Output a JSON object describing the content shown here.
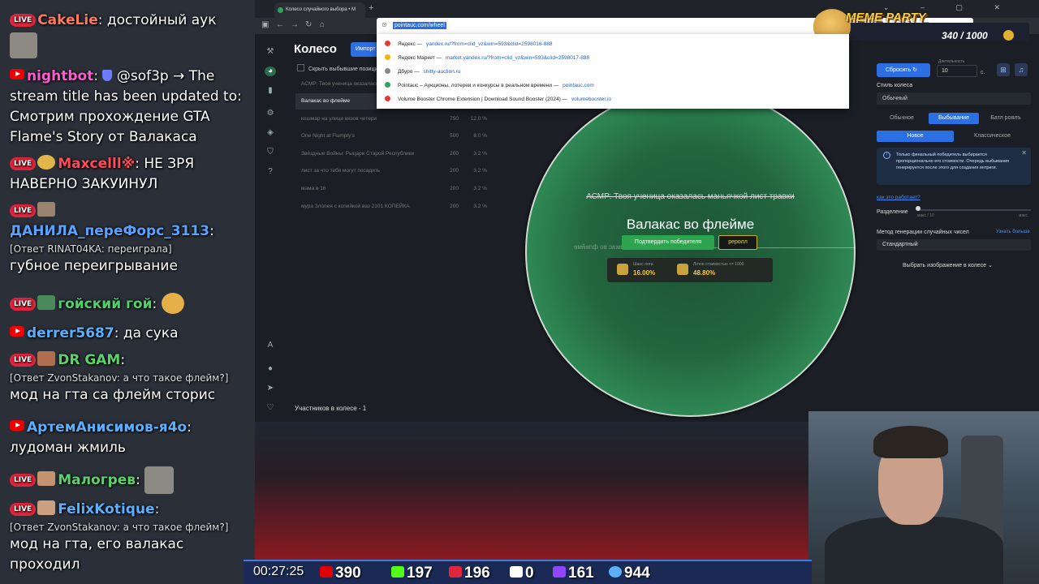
{
  "chat": {
    "messages": [
      {
        "user": "CakeLie",
        "text": "достойный аук",
        "color": "#ff7a5c",
        "platform": "live"
      },
      {
        "user": "nightbot",
        "text": "@sof3p → The stream title has been updated to: Смотрим прохождение GTA Flame's Story от Валакаса",
        "color": "#ff5ad0",
        "platform": "youtube"
      },
      {
        "user": "Maxcelll※",
        "text": "НЕ ЗРЯ НАВЕРНО ЗАКУИНУЛ",
        "color": "#ff4a5a",
        "platform": "live"
      },
      {
        "user": "ДАНИЛА_переФорс_3113",
        "reply": "[Ответ RINAT04KA: переиграла]",
        "text": "губное переигрывание",
        "color": "#5aa2ff",
        "platform": "live"
      },
      {
        "user": "гойский гой",
        "text": "",
        "color": "#4bd36a",
        "platform": "live"
      },
      {
        "user": "derrer5687",
        "text": "да сука",
        "color": "#5ab0ff",
        "platform": "youtube"
      },
      {
        "user": "DR GAM",
        "reply": "[Ответ ZvonStakanov: а что такое флейм?]",
        "text": "мод на гта са флейм сторис",
        "color": "#5ad46a",
        "platform": "live"
      },
      {
        "user": "АртемАнисимов-я4о",
        "text": "лудоман жмиль",
        "color": "#5ab0ff",
        "platform": "youtube"
      },
      {
        "user": "Малогрев",
        "text": "",
        "color": "#5ad46a",
        "platform": "live"
      },
      {
        "user": "FelixKotique",
        "reply": "[Ответ ZvonStakanov: а что такое флейм?]",
        "text": "мод на гта, его валакас проходил",
        "color": "#5ab0ff",
        "platform": "live"
      }
    ]
  },
  "browser": {
    "tab_title": "Колесо случайного выбора • М",
    "url": "pointauc.com/wheel",
    "suggestions": [
      {
        "title": "Яндекс",
        "url": "yandex.ru/?from=clid_vz&win=593&clid=2598016-888",
        "color": "#e53935"
      },
      {
        "title": "Яндекс Маркет",
        "url": "market.yandex.ru/?from=clid_vz&win=593&clid=2598017-888",
        "color": "#f5b400"
      },
      {
        "title": "Дбурo",
        "url": "shitty-auction.ru",
        "color": "#888888"
      },
      {
        "title": "Pointauc – Аукционы, лотереи и конкурсы в реальном времени",
        "url": "pointauc.com",
        "color": "#2ca55a"
      },
      {
        "title": "Volume Booster Chrome Extension | Download Sound Booster (2024)",
        "url": "volumebooster.io",
        "color": "#e53935"
      }
    ]
  },
  "app": {
    "title": "Колесо",
    "import_label": "Импорт",
    "hide_winners_label": "Скрыть выбывшие позиции",
    "participants": "Участников в колесе - 1",
    "lots": [
      {
        "name": "АСМР: Твоя ученица оказалась маньячкой лист травки",
        "amount": "",
        "pct": ""
      },
      {
        "name": "Валакас во флейме",
        "amount": "",
        "pct": ""
      },
      {
        "name": "кошмар на улице вязов четери",
        "amount": "750",
        "pct": "12.0 %"
      },
      {
        "name": "One Night at Flumpty's",
        "amount": "500",
        "pct": "8.0 %"
      },
      {
        "name": "Звёздные Войны: Рыцари Старой Республики",
        "amount": "200",
        "pct": "3.2 %"
      },
      {
        "name": "лист за что тебя могут посадить",
        "amount": "200",
        "pct": "3.2 %"
      },
      {
        "name": "мама в 16",
        "amount": "200",
        "pct": "3.2 %"
      },
      {
        "name": "мура Злопея с копейкой ваз 2101 КОПЕЙКА",
        "amount": "200",
        "pct": "3.2 %"
      }
    ],
    "wheel": {
      "struck_title": "АСМР: Твоя ученица оказалась маньячкой лист травки",
      "winner": "Валакас во флейме",
      "mirrored": "Валакас во флейме",
      "confirm_label": "Подтвердить победителя",
      "reroll_label": "реролл",
      "chance_label": "Шанс лота",
      "chance_value": "16.00%",
      "cost_label": "Лотов стоимостью <= 1000",
      "cost_value": "48.80%",
      "color": "#2f8a55"
    },
    "panel": {
      "reset_label": "Сбросить",
      "duration_label": "Длительность",
      "duration_value": "10",
      "duration_unit": "с.",
      "style_label": "Стиль колеса",
      "style_value": "Обычный",
      "mode_normal": "Обычное",
      "mode_elim": "Выбывание",
      "mode_battle": "Батл роялъ",
      "sub_new": "Новое",
      "sub_classic": "Классическое",
      "info_text": "Только финальный победитель выбирается пропорционально его стоимости. Очередь выбывания генерируется после этого для создания интриги.",
      "how_link": "как это работает?",
      "split_label": "Разделение",
      "split_min": "макс / 10",
      "split_max": "макс",
      "rng_label": "Метод генерации случайных чисел",
      "rng_link": "Узнать больше",
      "rng_value": "Стандартный",
      "image_label": "Выбрать изображение в колесе"
    }
  },
  "overlay": {
    "goal_title": "MEME PARTY",
    "goal_value": "340 / 1000",
    "timer": "00:27:25",
    "stats": [
      {
        "icon": "youtube-icon",
        "value": "390",
        "color": "#e00000"
      },
      {
        "icon": "kick-icon",
        "value": "197",
        "color": "#53fc18"
      },
      {
        "icon": "vk-live-icon",
        "value": "196",
        "color": "#e0263c"
      },
      {
        "icon": "rumble-icon",
        "value": "0",
        "color": "#ffffff"
      },
      {
        "icon": "twitch-icon",
        "value": "161",
        "color": "#9146ff"
      },
      {
        "icon": "viewers-icon",
        "value": "944",
        "color": "#5ab0ff"
      }
    ]
  }
}
